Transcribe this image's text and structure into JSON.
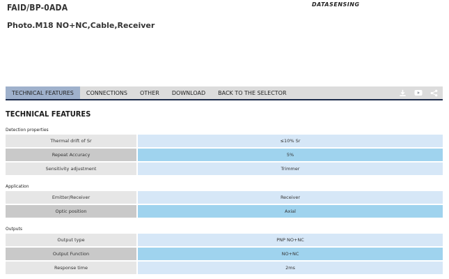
{
  "product": {
    "code": "FAID/BP-0ADA",
    "description": "Photo.M18 NO+NC,Cable,Receiver"
  },
  "brand": {
    "name": "DATASENSING"
  },
  "tabs": [
    {
      "label": "TECHNICAL FEATURES",
      "active": true
    },
    {
      "label": "CONNECTIONS",
      "active": false
    },
    {
      "label": "OTHER",
      "active": false
    },
    {
      "label": "DOWNLOAD",
      "active": false
    },
    {
      "label": "BACK TO THE SELECTOR",
      "active": false
    }
  ],
  "actions": {
    "download_icon": "download-icon",
    "video_icon": "video-icon",
    "share_icon": "share-icon"
  },
  "section_title": "TECHNICAL FEATURES",
  "groups": [
    {
      "label": "Detection properties",
      "rows": [
        {
          "label": "Thermal drift of Sr",
          "value": "≤10% Sr"
        },
        {
          "label": "Repeat Accuracy",
          "value": "5%"
        },
        {
          "label": "Sensitivity adjustment",
          "value": "Trimmer"
        }
      ]
    },
    {
      "label": "Application",
      "rows": [
        {
          "label": "Emitter/Receiver",
          "value": "Receiver"
        },
        {
          "label": "Optic position",
          "value": "Axial"
        }
      ]
    },
    {
      "label": "Outputs",
      "rows": [
        {
          "label": "Output type",
          "value": "PNP NO+NC"
        },
        {
          "label": "Output Function",
          "value": "NO+NC"
        },
        {
          "label": "Response time",
          "value": "2ms"
        }
      ]
    }
  ],
  "colors": {
    "tabbar_bg": "#dcdcdc",
    "tab_active": "#9fb1cc",
    "tabbar_border": "#1b2a4a",
    "label_light": "#e6e6e6",
    "label_dark": "#c9c9c9",
    "value_light": "#d6e7f7",
    "value_dark": "#9fd3ee"
  }
}
